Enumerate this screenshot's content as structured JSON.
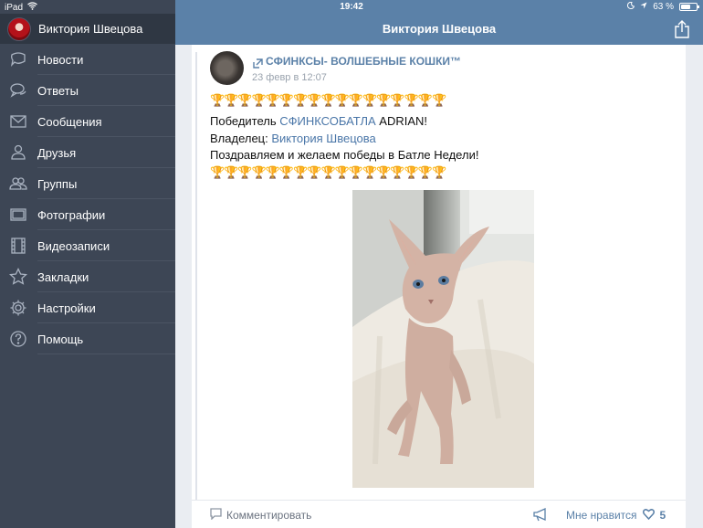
{
  "status_bar": {
    "device": "iPad",
    "time": "19:42",
    "battery": "63 %",
    "battery_level": 0.63
  },
  "sidebar": {
    "profile_name": "Виктория Швецова",
    "items": [
      {
        "label": "Новости",
        "icon": "news-icon"
      },
      {
        "label": "Ответы",
        "icon": "replies-icon"
      },
      {
        "label": "Сообщения",
        "icon": "messages-icon"
      },
      {
        "label": "Друзья",
        "icon": "friends-icon"
      },
      {
        "label": "Группы",
        "icon": "groups-icon"
      },
      {
        "label": "Фотографии",
        "icon": "photos-icon"
      },
      {
        "label": "Видеозаписи",
        "icon": "videos-icon"
      },
      {
        "label": "Закладки",
        "icon": "bookmarks-icon"
      },
      {
        "label": "Настройки",
        "icon": "settings-icon"
      },
      {
        "label": "Помощь",
        "icon": "help-icon"
      }
    ]
  },
  "navbar": {
    "title": "Виктория Швецова",
    "share_icon": "share-icon"
  },
  "post": {
    "group_name": "СФИНКСЫ- ВОЛШЕБНЫЕ КОШКИ™",
    "date": "23 февр в 12:07",
    "trophies": "🏆🏆🏆🏆🏆🏆🏆🏆🏆🏆🏆🏆🏆🏆🏆🏆🏆",
    "winner_prefix": "Победитель ",
    "winner_link": "СФИНКСОБАТЛА",
    "winner_suffix": " ADRIAN!",
    "owner_prefix": "Владелец: ",
    "owner_link": "Виктория Швецова",
    "congrats": "Поздравляем и желаем победы в Батле Недели!",
    "footer": {
      "comment_label": "Комментировать",
      "like_label": "Мне нравится",
      "like_count": "5"
    }
  },
  "colors": {
    "navbar": "#5b81a8",
    "sidebar": "#3d4655",
    "link": "#4a76a8"
  }
}
